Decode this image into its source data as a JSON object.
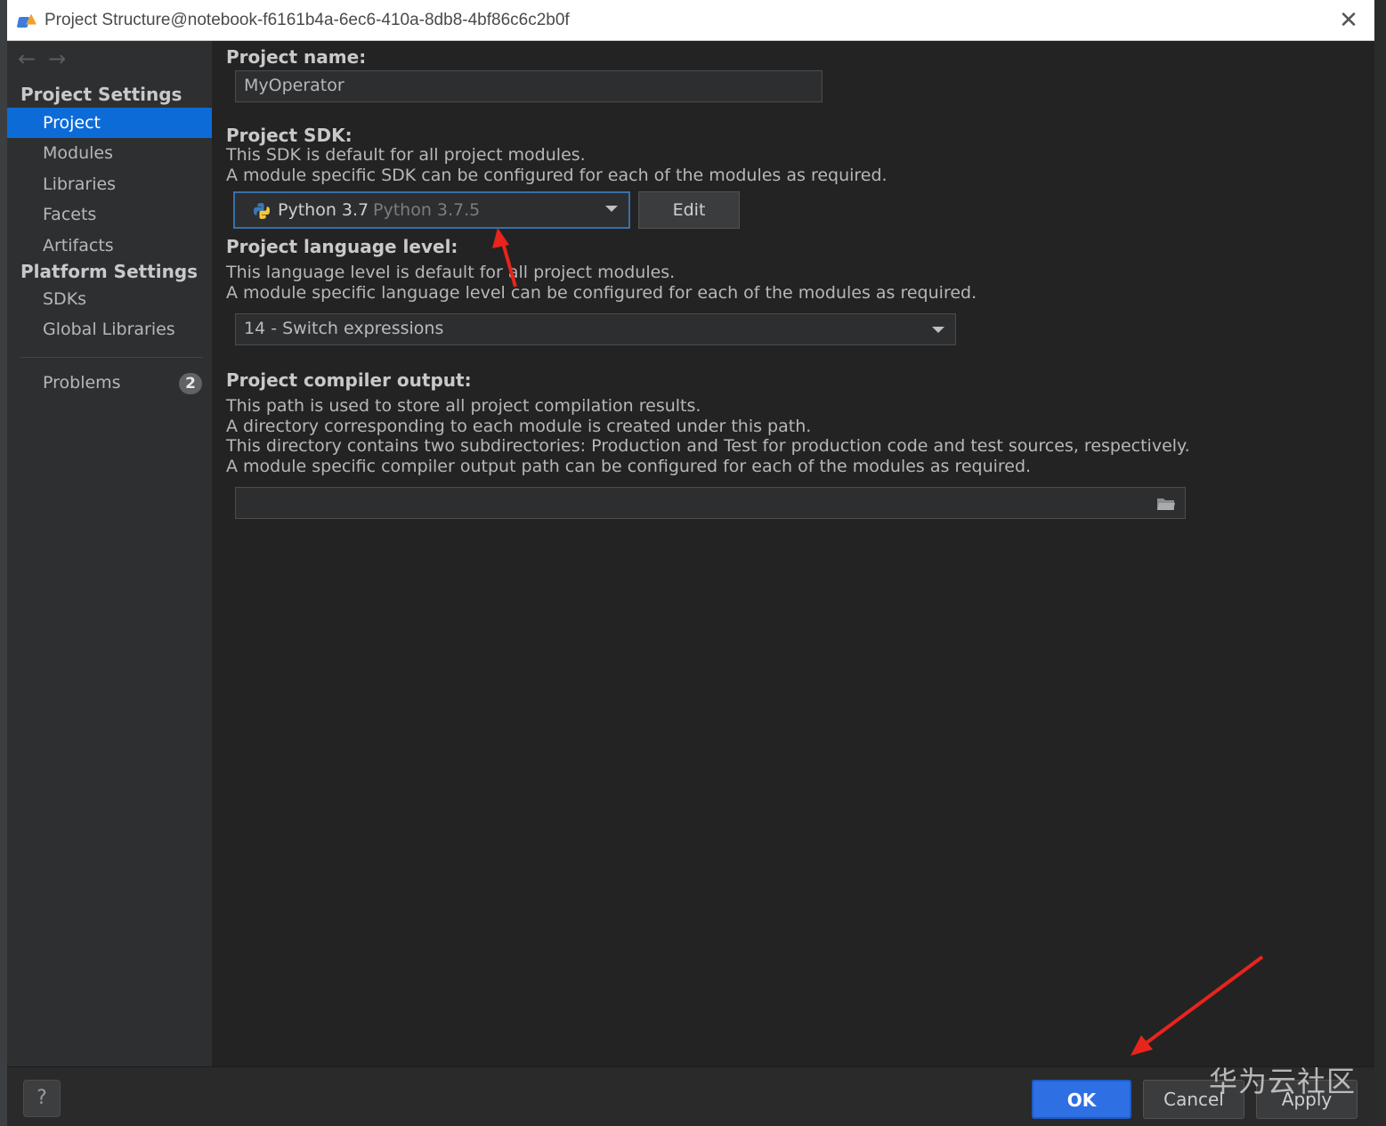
{
  "window": {
    "title": "Project Structure@notebook-f6161b4a-6ec6-410a-8db8-4bf86c6c2b0f",
    "close_glyph": "✕"
  },
  "sidebar": {
    "back_glyph": "←",
    "forward_glyph": "→",
    "project_settings_title": "Project Settings",
    "project_settings_items": [
      {
        "label": "Project",
        "selected": true
      },
      {
        "label": "Modules"
      },
      {
        "label": "Libraries"
      },
      {
        "label": "Facets"
      },
      {
        "label": "Artifacts"
      }
    ],
    "platform_settings_title": "Platform Settings",
    "platform_settings_items": [
      {
        "label": "SDKs"
      },
      {
        "label": "Global Libraries"
      }
    ],
    "problems": {
      "label": "Problems",
      "count": "2"
    }
  },
  "main": {
    "project_name": {
      "label": "Project name:",
      "value": "MyOperator"
    },
    "project_sdk": {
      "label": "Project SDK:",
      "desc1": "This SDK is default for all project modules.",
      "desc2": "A module specific SDK can be configured for each of the modules as required.",
      "selected_name": "Python 3.7",
      "selected_version": "Python 3.7.5",
      "edit_label": "Edit"
    },
    "language_level": {
      "label": "Project language level:",
      "desc1": "This language level is default for all project modules.",
      "desc2": "A module specific language level can be configured for each of the modules as required.",
      "value": "14 - Switch expressions"
    },
    "compiler_output": {
      "label": "Project compiler output:",
      "desc1": "This path is used to store all project compilation results.",
      "desc2": "A directory corresponding to each module is created under this path.",
      "desc3": "This directory contains two subdirectories: Production and Test for production code and test sources, respectively.",
      "desc4": "A module specific compiler output path can be configured for each of the modules as required.",
      "value": ""
    }
  },
  "footer": {
    "help_label": "?",
    "ok_label": "OK",
    "cancel_label": "Cancel",
    "apply_label": "Apply"
  },
  "watermark": "华为云社区",
  "colors": {
    "accent": "#2f6fe4",
    "selection": "#0d6bd8",
    "annotation_arrow": "#e8241c"
  }
}
